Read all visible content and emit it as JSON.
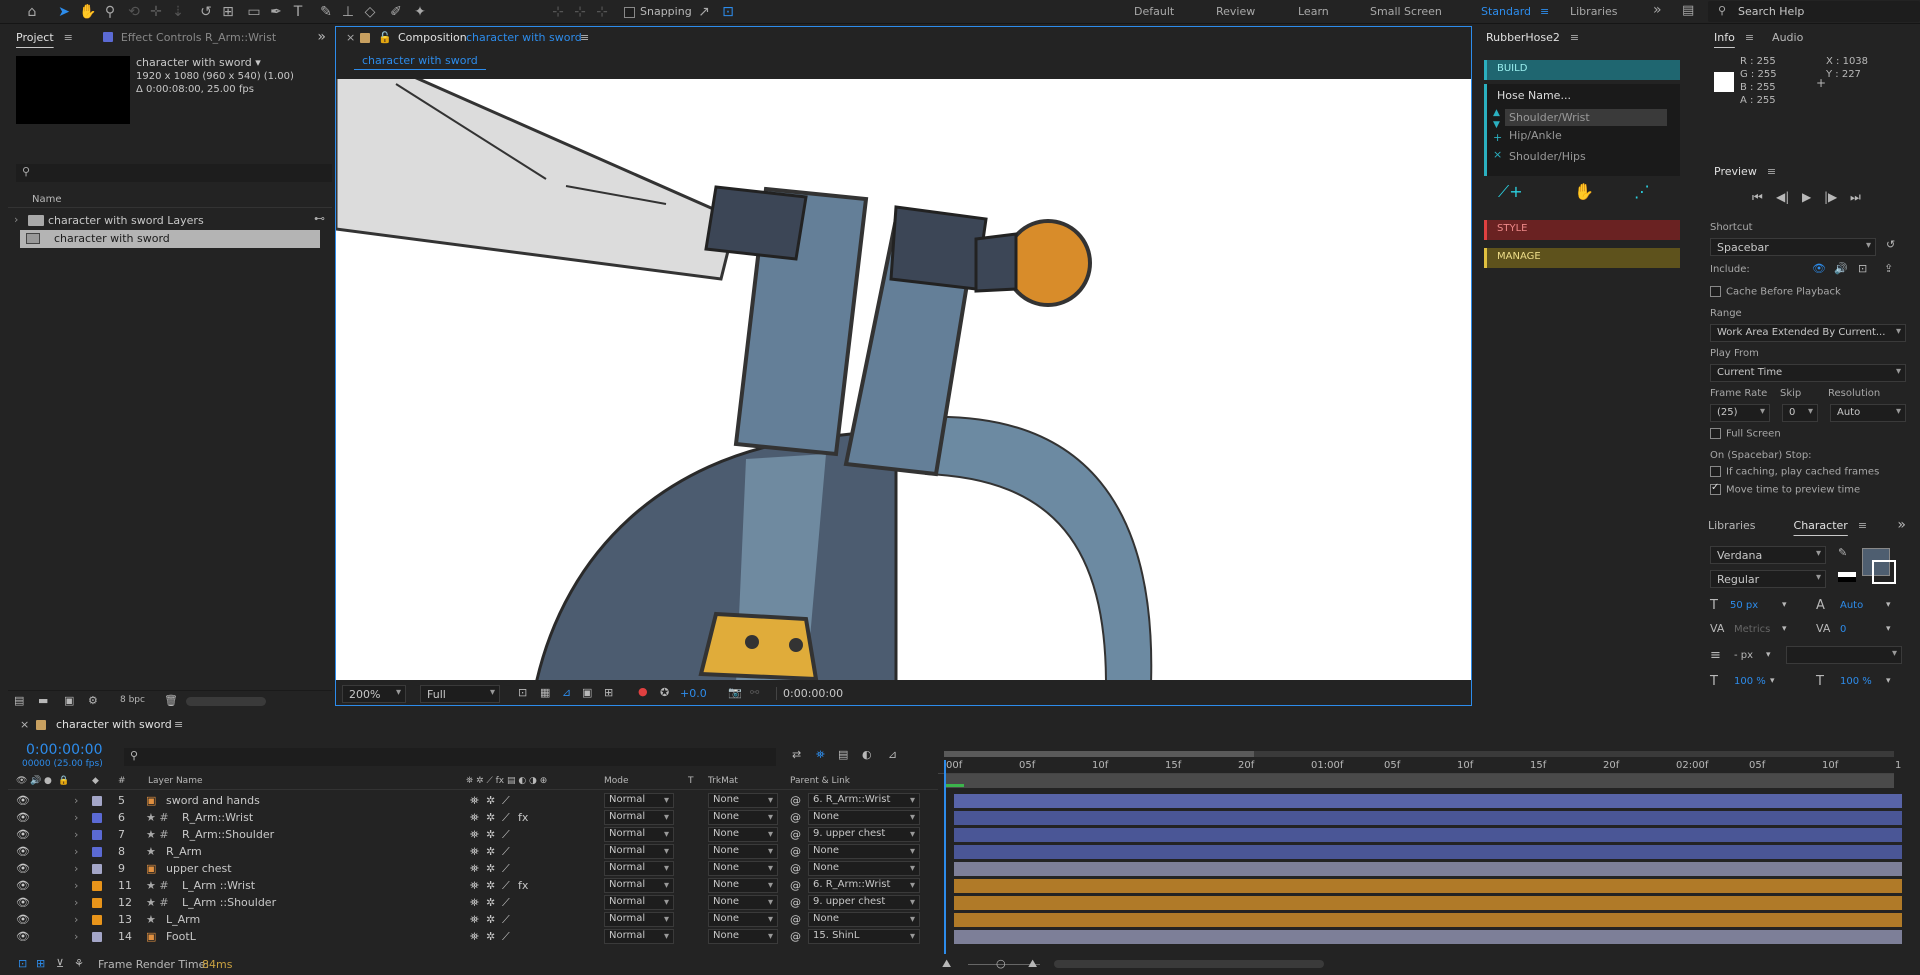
{
  "toolbar": {
    "snapping_label": "Snapping",
    "workspaces": [
      "Default",
      "Review",
      "Learn",
      "Small Screen",
      "Standard",
      "Libraries"
    ],
    "active_workspace": "Standard",
    "search_placeholder": "Search Help"
  },
  "project_panel": {
    "tab_project": "Project",
    "tab_effect_controls": "Effect Controls R_Arm::Wrist",
    "comp_name": "character with sword ▾",
    "comp_dims": "1920 x 1080  (960 x 540) (1.00)",
    "comp_duration": "Δ 0:00:08:00, 25.00 fps",
    "col_name": "Name",
    "items": [
      {
        "name": "character with sword Layers",
        "type": "folder"
      },
      {
        "name": "character with sword",
        "type": "comp"
      }
    ],
    "bpc": "8 bpc"
  },
  "composition": {
    "tab_prefix": "Composition",
    "tab_name": "character with sword",
    "breadcrumb": "character with sword",
    "zoom": "200%",
    "resolution": "Full",
    "exposure": "+0.0",
    "timecode": "0:00:00:00"
  },
  "rubberhose": {
    "title": "RubberHose2",
    "build": "BUILD",
    "hose_name_placeholder": "Hose Name...",
    "list": [
      "Shoulder/Wrist",
      "Hip/Ankle",
      "Shoulder/Hips"
    ],
    "style": "STYLE",
    "manage": "MANAGE"
  },
  "info": {
    "tab_info": "Info",
    "tab_audio": "Audio",
    "r": "R :  255",
    "g": "G :  255",
    "b": "B :  255",
    "a": "A :  255",
    "x": "X : 1038",
    "y": "Y :  227"
  },
  "preview": {
    "title": "Preview",
    "shortcut_label": "Shortcut",
    "shortcut_value": "Spacebar",
    "include_label": "Include:",
    "cache_label": "Cache Before Playback",
    "range_label": "Range",
    "range_value": "Work Area Extended By Current...",
    "play_from_label": "Play From",
    "play_from_value": "Current Time",
    "frame_rate_label": "Frame Rate",
    "skip_label": "Skip",
    "resolution_label": "Resolution",
    "frame_rate_value": "(25)",
    "skip_value": "0",
    "resolution_value": "Auto",
    "full_screen_label": "Full Screen",
    "stop_label": "On (Spacebar) Stop:",
    "caching_label": "If caching, play cached frames",
    "move_time_label": "Move time to preview time"
  },
  "character": {
    "tab_libraries": "Libraries",
    "tab_character": "Character",
    "font": "Verdana",
    "style": "Regular",
    "size": "50 px",
    "leading": "Auto",
    "kerning": "Metrics",
    "tracking": "0",
    "stroke_width": "- px",
    "vscale": "100 %",
    "hscale": "100 %"
  },
  "timeline": {
    "tab_name": "character with sword",
    "timecode": "0:00:00:00",
    "frame_info": "00000 (25.00 fps)",
    "col_num": "#",
    "col_layer": "Layer Name",
    "col_mode": "Mode",
    "col_t": "T",
    "col_trkmat": "TrkMat",
    "col_parent": "Parent & Link",
    "ruler": [
      "00f",
      "05f",
      "10f",
      "15f",
      "20f",
      "01:00f",
      "05f",
      "10f",
      "15f",
      "20f",
      "02:00f",
      "05f",
      "10f",
      "1"
    ],
    "layers": [
      {
        "num": "5",
        "name": "sword and hands",
        "color": "#a4a6c8",
        "kind": "shape",
        "fx": false,
        "mode": "Normal",
        "trkmat": "None",
        "parent": "6. R_Arm::Wrist",
        "bar": "#5864a8"
      },
      {
        "num": "6",
        "name": "R_Arm::Wrist",
        "color": "#5b6ad4",
        "kind": "null",
        "fx": true,
        "mode": "Normal",
        "trkmat": "None",
        "parent": "None",
        "bar": "#4a5696"
      },
      {
        "num": "7",
        "name": "R_Arm::Shoulder",
        "color": "#5b6ad4",
        "kind": "null",
        "fx": false,
        "mode": "Normal",
        "trkmat": "None",
        "parent": "9. upper chest",
        "bar": "#4a5696"
      },
      {
        "num": "8",
        "name": "R_Arm",
        "color": "#5b6ad4",
        "kind": "star",
        "fx": false,
        "mode": "Normal",
        "trkmat": "None",
        "parent": "None",
        "bar": "#4a5696"
      },
      {
        "num": "9",
        "name": "upper chest",
        "color": "#a4a6c8",
        "kind": "shape",
        "fx": false,
        "mode": "Normal",
        "trkmat": "None",
        "parent": "None",
        "bar": "#7d7f98"
      },
      {
        "num": "11",
        "name": "L_Arm ::Wrist",
        "color": "#e8941a",
        "kind": "null",
        "fx": true,
        "mode": "Normal",
        "trkmat": "None",
        "parent": "6. R_Arm::Wrist",
        "bar": "#b07a28"
      },
      {
        "num": "12",
        "name": "L_Arm ::Shoulder",
        "color": "#e8941a",
        "kind": "null",
        "fx": false,
        "mode": "Normal",
        "trkmat": "None",
        "parent": "9. upper chest",
        "bar": "#b07a28"
      },
      {
        "num": "13",
        "name": "L_Arm",
        "color": "#e8941a",
        "kind": "star",
        "fx": false,
        "mode": "Normal",
        "trkmat": "None",
        "parent": "None",
        "bar": "#b07a28"
      },
      {
        "num": "14",
        "name": "FootL",
        "color": "#a4a6c8",
        "kind": "shape",
        "fx": false,
        "mode": "Normal",
        "trkmat": "None",
        "parent": "15. ShinL",
        "bar": "#7d7f98"
      }
    ],
    "render_time_label": "Frame Render Time:",
    "render_time_value": "84ms"
  },
  "colors": {
    "accent": "#2d8ceb",
    "build": "#1f6670",
    "style": "#8a2a2a",
    "manage": "#7a6a1a"
  }
}
